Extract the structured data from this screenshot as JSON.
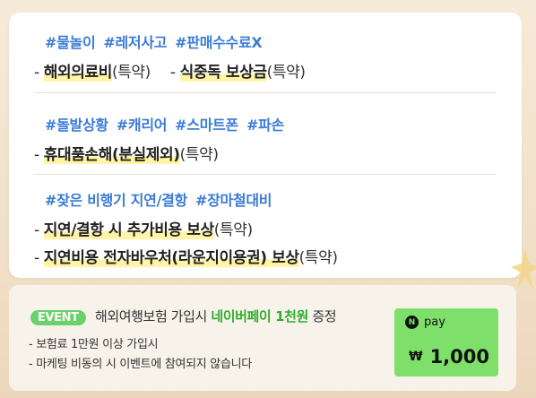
{
  "sections": [
    {
      "tags": [
        "#물놀이",
        "#레저사고",
        "#판매수수료X"
      ],
      "lines": [
        {
          "parts": [
            {
              "bold": "해외의료비",
              "normal": "(특약)"
            },
            {
              "bold": "식중독 보상금",
              "normal": "(특약)"
            }
          ]
        }
      ]
    },
    {
      "tags": [
        "#돌발상황",
        "#캐리어",
        "#스마트폰",
        "#파손"
      ],
      "lines": [
        {
          "parts": [
            {
              "bold": "휴대품손해(분실제외)",
              "normal": "(특약)"
            }
          ]
        }
      ]
    },
    {
      "tags": [
        "#잦은 비행기 지연/결항",
        "#장마철대비"
      ],
      "lines": [
        {
          "parts": [
            {
              "bold": "지연/결항 시 추가비용 보상",
              "normal": "(특약)"
            }
          ]
        },
        {
          "parts": [
            {
              "bold": "지연비용 전자바우처(라운지이용권) 보상",
              "normal": "(특약)"
            }
          ]
        }
      ]
    }
  ],
  "event": {
    "badge": "EVENT",
    "title_pre": "해외여행보험 가입시",
    "title_highlight": "네이버페이 1천원",
    "title_post": "증정",
    "bullets": [
      "- 보험료 1만원 이상 가입시",
      "- 마케팅 비동의 시 이벤트에 참여되지 않습니다"
    ],
    "npay": {
      "logo_n": "N",
      "logo_text": "pay",
      "currency": "₩",
      "amount": "1,000"
    }
  },
  "colors": {
    "tag": "#3a7bd5",
    "highlight": "#fff4a8",
    "event_green": "#6bd16b",
    "npay_green": "#7ee06b"
  }
}
